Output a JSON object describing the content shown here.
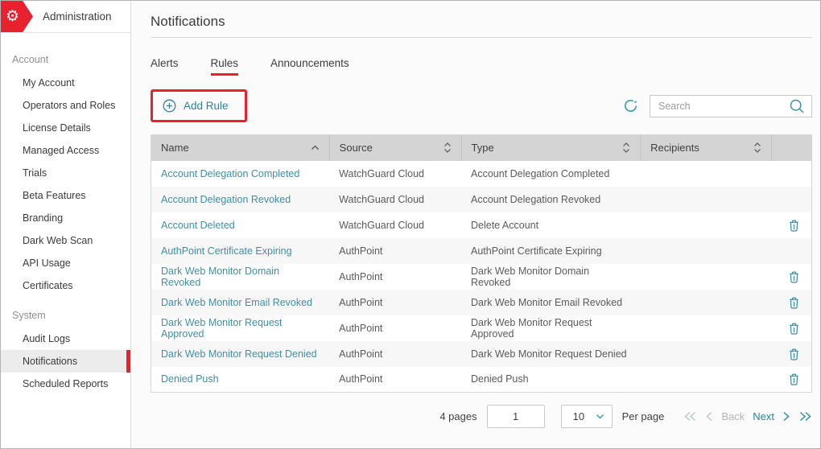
{
  "header": {
    "app_title": "Administration"
  },
  "sidebar": {
    "sections": [
      {
        "label": "Account",
        "items": [
          {
            "label": "My Account"
          },
          {
            "label": "Operators and Roles"
          },
          {
            "label": "License Details"
          },
          {
            "label": "Managed Access"
          },
          {
            "label": "Trials"
          },
          {
            "label": "Beta Features"
          },
          {
            "label": "Branding"
          },
          {
            "label": "Dark Web Scan"
          },
          {
            "label": "API Usage"
          },
          {
            "label": "Certificates"
          }
        ]
      },
      {
        "label": "System",
        "items": [
          {
            "label": "Audit Logs"
          },
          {
            "label": "Notifications",
            "selected": true
          },
          {
            "label": "Scheduled Reports"
          }
        ]
      }
    ]
  },
  "main": {
    "title": "Notifications",
    "tabs": [
      {
        "label": "Alerts"
      },
      {
        "label": "Rules",
        "active": true
      },
      {
        "label": "Announcements"
      }
    ],
    "add_rule_label": "Add Rule",
    "search": {
      "placeholder": "Search"
    },
    "table": {
      "columns": [
        {
          "label": "Name",
          "sort": "asc"
        },
        {
          "label": "Source",
          "sort": "both"
        },
        {
          "label": "Type",
          "sort": "both"
        },
        {
          "label": "Recipients",
          "sort": "both"
        }
      ],
      "rows": [
        {
          "name": "Account Delegation Completed",
          "source": "WatchGuard Cloud",
          "type": "Account Delegation Completed",
          "recipients": "",
          "deletable": false
        },
        {
          "name": "Account Delegation Revoked",
          "source": "WatchGuard Cloud",
          "type": "Account Delegation Revoked",
          "recipients": "",
          "deletable": false
        },
        {
          "name": "Account Deleted",
          "source": "WatchGuard Cloud",
          "type": "Delete Account",
          "recipients": "",
          "deletable": true
        },
        {
          "name": "AuthPoint Certificate Expiring",
          "source": "AuthPoint",
          "type": "AuthPoint Certificate Expiring",
          "recipients": "",
          "deletable": false
        },
        {
          "name": "Dark Web Monitor Domain Revoked",
          "source": "AuthPoint",
          "type": "Dark Web Monitor Domain Revoked",
          "recipients": "",
          "deletable": true
        },
        {
          "name": "Dark Web Monitor Email Revoked",
          "source": "AuthPoint",
          "type": "Dark Web Monitor Email Revoked",
          "recipients": "",
          "deletable": true
        },
        {
          "name": "Dark Web Monitor Request Approved",
          "source": "AuthPoint",
          "type": "Dark Web Monitor Request Approved",
          "recipients": "",
          "deletable": true
        },
        {
          "name": "Dark Web Monitor Request Denied",
          "source": "AuthPoint",
          "type": "Dark Web Monitor Request Denied",
          "recipients": "",
          "deletable": true
        },
        {
          "name": "Denied Push",
          "source": "AuthPoint",
          "type": "Denied Push",
          "recipients": "",
          "deletable": true
        }
      ]
    },
    "pagination": {
      "pages_label": "4 pages",
      "page_value": "1",
      "per_page_value": "10",
      "per_page_label": "Per page",
      "back_label": "Back",
      "next_label": "Next"
    }
  },
  "icons": {
    "logo": "gear-icon",
    "add": "plus-circle-icon",
    "refresh": "refresh-icon",
    "search": "search-icon",
    "delete": "trash-icon",
    "sort_asc": "chevron-up-icon",
    "sort_both": "chevron-up-down-icon"
  },
  "colors": {
    "accent_red": "#e5222d",
    "link_teal": "#3f8fa3",
    "icon_teal": "#2e9bb0",
    "button_teal": "#2d8299",
    "table_header_gray": "#d4d4d4",
    "selected_nav_bg": "#ececec",
    "disabled_gray": "#b5b5b5"
  }
}
